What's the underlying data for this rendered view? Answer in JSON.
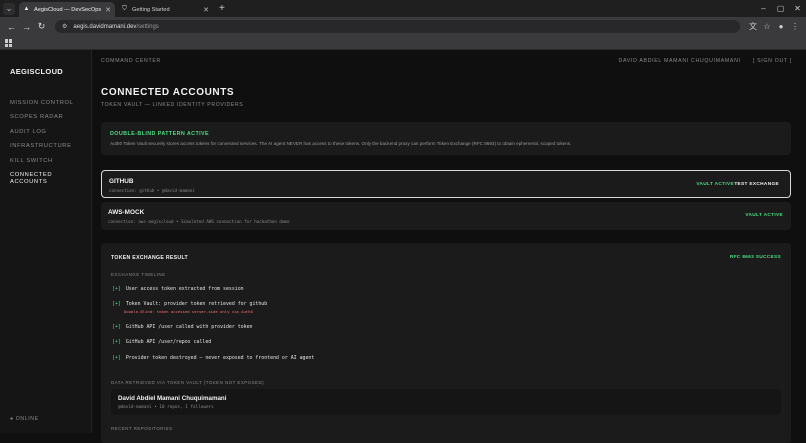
{
  "browser": {
    "tabs": [
      {
        "title": "AegisCloud — DevSecOps Sent",
        "active": true
      },
      {
        "title": "Getting Started",
        "active": false
      }
    ],
    "url_domain": "aegis.davidmamani.dev",
    "url_path": "/settings"
  },
  "sidebar": {
    "logo": "AEGISCLOUD",
    "items": [
      {
        "label": "MISSION CONTROL",
        "active": false
      },
      {
        "label": "SCOPES RADAR",
        "active": false
      },
      {
        "label": "AUDIT LOG",
        "active": false
      },
      {
        "label": "INFRASTRUCTURE",
        "active": false
      },
      {
        "label": "KILL SWITCH",
        "active": false
      },
      {
        "label": "CONNECTED ACCOUNTS",
        "active": true
      }
    ],
    "status": "● ONLINE"
  },
  "header": {
    "section": "COMMAND CENTER",
    "user": "DAVID ABDIEL MAMANI CHUQUIMAMANI",
    "signout": "[ SIGN OUT ]"
  },
  "page": {
    "title": "CONNECTED ACCOUNTS",
    "subtitle": "TOKEN VAULT — LINKED IDENTITY PROVIDERS"
  },
  "notice": {
    "title": "DOUBLE-BLIND PATTERN ACTIVE",
    "text": "Auth0 Token Vault securely stores access tokens for connected services. The AI agent NEVER has access to these tokens. Only the backend proxy can perform Token Exchange (RFC 8693) to obtain ephemeral, scoped tokens."
  },
  "accounts": [
    {
      "name": "GITHUB",
      "connection": "connection: github • @david-mamani",
      "status": "VAULT ACTIVE",
      "action": "TEST EXCHANGE",
      "selected": true
    },
    {
      "name": "AWS-MOCK",
      "connection": "connection: aws-aegiscloud • Simulated AWS connection for hackathon demo",
      "status": "VAULT ACTIVE",
      "action": "",
      "selected": false
    }
  ],
  "result": {
    "title": "TOKEN EXCHANGE RESULT",
    "status": "RFC 8693 SUCCESS",
    "timeline_label": "EXCHANGE TIMELINE",
    "steps": [
      {
        "mark": "[+]",
        "text": "User access token extracted from session",
        "note": ""
      },
      {
        "mark": "[+]",
        "text": "Token Vault: provider token retrieved for github",
        "note": "Double-Blind: token accessed server-side only via Auth0"
      },
      {
        "mark": "[+]",
        "text": "GitHub API /user called with provider token",
        "note": ""
      },
      {
        "mark": "[+]",
        "text": "GitHub API /user/repos called",
        "note": ""
      },
      {
        "mark": "[+]",
        "text": "Provider token destroyed — never exposed to frontend or AI agent",
        "note": ""
      }
    ],
    "data_label": "DATA RETRIEVED VIA TOKEN VAULT (TOKEN NOT EXPOSED)",
    "user_name": "David Abdiel Mamani Chuquimamani",
    "user_detail": "@david-mamani • 10 repos, 1 followers",
    "repos_label": "RECENT REPOSITORIES"
  },
  "colors": {
    "accent_green": "#4ade80",
    "note_red": "#f87171",
    "background": "#0f0f10",
    "card": "#1b1b1c"
  }
}
